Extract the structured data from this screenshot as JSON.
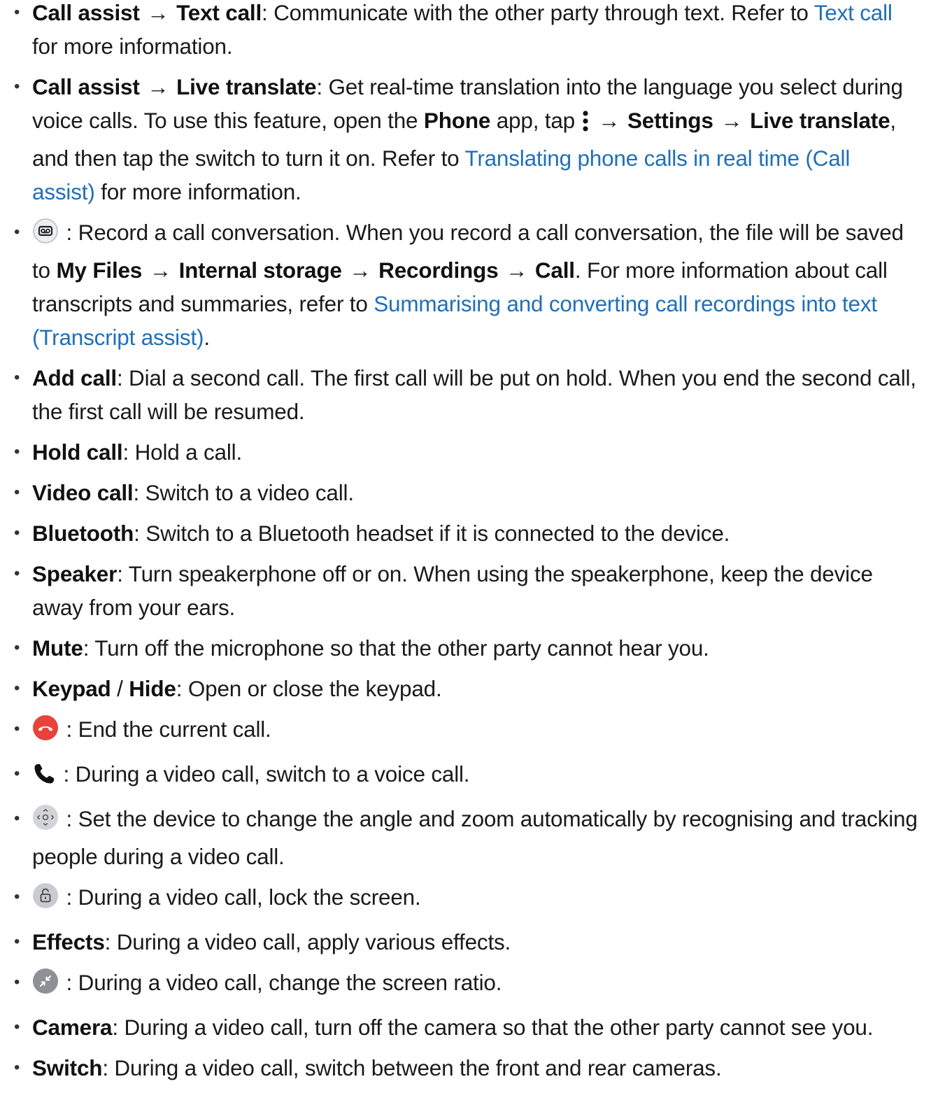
{
  "items": [
    {
      "b1": "Call assist",
      "arrow": "→",
      "b2": "Text call",
      "t1": ": Communicate with the other party through text. Refer to ",
      "link": "Text call",
      "t2": " for more information."
    },
    {
      "b1": "Call assist",
      "arrow": "→",
      "b2": "Live translate",
      "t1": ": Get real-time translation into the language you select during voice calls. To use this feature, open the ",
      "b3": "Phone",
      "t2": " app, tap ",
      "b4": "Settings",
      "b5": "Live translate",
      "t3": ", and then tap the switch to turn it on. Refer to ",
      "link": "Translating phone calls in real time (Call assist)",
      "t4": " for more information."
    },
    {
      "icon": "record-icon",
      "t1": " : Record a call conversation. When you record a call conversation, the file will be saved to ",
      "b1": "My Files",
      "arrow": "→",
      "b2": "Internal storage",
      "b3": "Recordings",
      "b4": "Call",
      "t2": ". For more information about call transcripts and summaries, refer to ",
      "link": "Summarising and converting call recordings into text (Transcript assist)",
      "t3": "."
    },
    {
      "b1": "Add call",
      "t1": ": Dial a second call. The first call will be put on hold. When you end the second call, the first call will be resumed."
    },
    {
      "b1": "Hold call",
      "t1": ": Hold a call."
    },
    {
      "b1": "Video call",
      "t1": ": Switch to a video call."
    },
    {
      "b1": "Bluetooth",
      "t1": ": Switch to a Bluetooth headset if it is connected to the device."
    },
    {
      "b1": "Speaker",
      "t1": ": Turn speakerphone off or on. When using the speakerphone, keep the device away from your ears."
    },
    {
      "b1": "Mute",
      "t1": ": Turn off the microphone so that the other party cannot hear you."
    },
    {
      "b1": "Keypad",
      "sep": " / ",
      "b2": "Hide",
      "t1": ": Open or close the keypad."
    },
    {
      "icon": "end-call-icon",
      "t1": " : End the current call."
    },
    {
      "icon": "voice-call-icon",
      "t1": " : During a video call, switch to a voice call."
    },
    {
      "icon": "auto-framing-icon",
      "t1": " : Set the device to change the angle and zoom automatically by recognising and tracking people during a video call."
    },
    {
      "icon": "lock-icon",
      "t1": " : During a video call, lock the screen."
    },
    {
      "b1": "Effects",
      "t1": ": During a video call, apply various effects."
    },
    {
      "icon": "screen-ratio-icon",
      "t1": " : During a video call, change the screen ratio."
    },
    {
      "b1": "Camera",
      "t1": ": During a video call, turn off the camera so that the other party cannot see you."
    },
    {
      "b1": "Switch",
      "t1": ": During a video call, switch between the front and rear cameras."
    }
  ],
  "colors": {
    "link": "#1f6fba",
    "end_call": "#e8423a",
    "icon_gray": "#c9cbd0"
  }
}
